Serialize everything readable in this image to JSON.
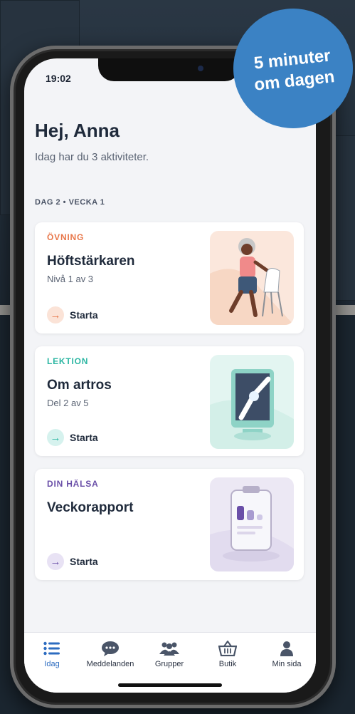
{
  "status": {
    "time": "19:02"
  },
  "greeting": "Hej, Anna",
  "subtitle": "Idag har du 3 aktiviteter.",
  "day_label": "DAG 2 • VECKA 1",
  "badge": {
    "line1": "5 minuter",
    "line2": "om dagen"
  },
  "cards": [
    {
      "category": "ÖVNING",
      "title": "Höftstärkaren",
      "meta": "Nivå 1 av 3",
      "action": "Starta",
      "accent": "#e8774a"
    },
    {
      "category": "LEKTION",
      "title": "Om artros",
      "meta": "Del 2 av 5",
      "action": "Starta",
      "accent": "#2bb6a2"
    },
    {
      "category": "DIN HÄLSA",
      "title": "Veckorapport",
      "meta": "",
      "action": "Starta",
      "accent": "#6a4fa8"
    }
  ],
  "tabs": [
    {
      "label": "Idag",
      "icon": "list-icon",
      "active": true
    },
    {
      "label": "Meddelanden",
      "icon": "chat-icon"
    },
    {
      "label": "Grupper",
      "icon": "group-icon"
    },
    {
      "label": "Butik",
      "icon": "basket-icon"
    },
    {
      "label": "Min sida",
      "icon": "person-icon"
    }
  ],
  "colors": {
    "active_tab": "#2d6cc0",
    "badge": "#3b82c4"
  }
}
